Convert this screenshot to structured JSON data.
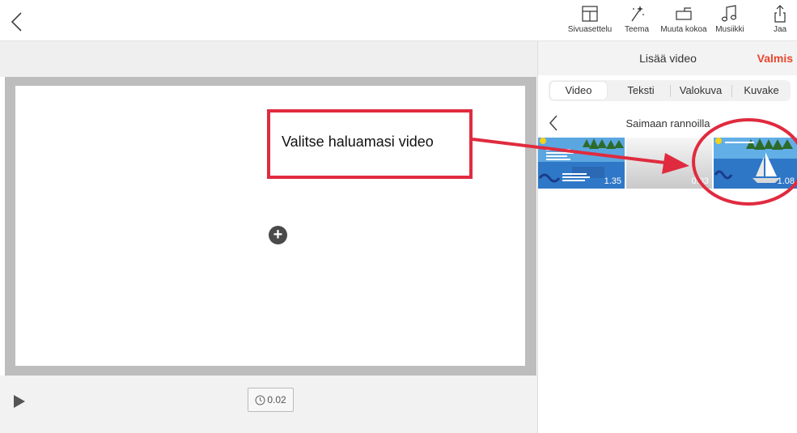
{
  "toolbar": {
    "tools": [
      {
        "label": "Sivuasettelu",
        "icon": "layout-icon"
      },
      {
        "label": "Teema",
        "icon": "magic-wand-icon"
      },
      {
        "label": "Muuta kokoa",
        "icon": "resize-icon"
      },
      {
        "label": "Musiikki",
        "icon": "music-icon"
      },
      {
        "label": "Jaa",
        "icon": "share-icon"
      }
    ]
  },
  "editor": {
    "duration": "0.02"
  },
  "panel": {
    "title": "Lisää video",
    "done_label": "Valmis",
    "tabs": [
      "Video",
      "Teksti",
      "Valokuva",
      "Kuvake"
    ],
    "active_tab": "Video",
    "album_title": "Saimaan rannoilla",
    "videos": [
      {
        "duration": "1.35"
      },
      {
        "duration": "0.03"
      },
      {
        "duration": "1.08"
      }
    ]
  },
  "annotation": {
    "text": "Valitse haluamasi video",
    "color": "#e02b3f"
  },
  "colors": {
    "accent": "#e8452c",
    "annotation": "#e02b3f"
  }
}
